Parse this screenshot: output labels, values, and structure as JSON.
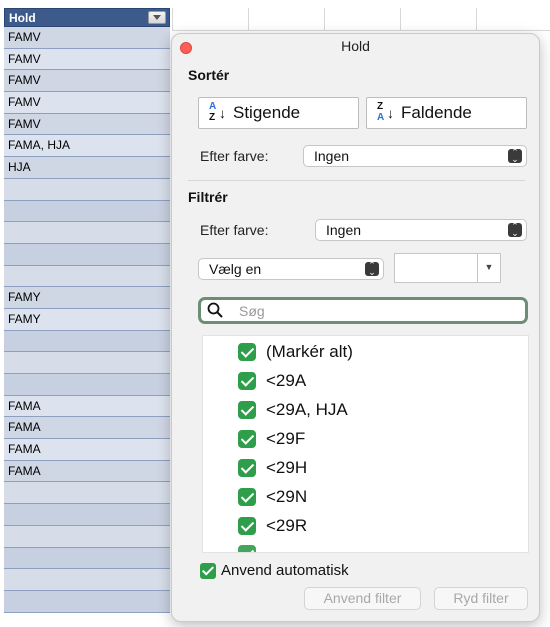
{
  "column": {
    "header": "Hold",
    "rows": [
      "FAMV",
      "FAMV",
      "FAMV",
      "FAMV",
      "FAMV",
      "FAMA, HJA",
      "HJA",
      "",
      "",
      "",
      "",
      "",
      "FAMY",
      "FAMY",
      "",
      "",
      "",
      "FAMA",
      "FAMA",
      "FAMA",
      "FAMA",
      "",
      "",
      "",
      "",
      "",
      ""
    ]
  },
  "panel": {
    "title": "Hold",
    "sort": {
      "heading": "Sortér",
      "ascending": "Stigende",
      "descending": "Faldende",
      "by_color_label": "Efter farve:",
      "by_color_value": "Ingen"
    },
    "filter": {
      "heading": "Filtrér",
      "by_color_label": "Efter farve:",
      "by_color_value": "Ingen",
      "choose": "Vælg en",
      "combo_value": "",
      "search_placeholder": "Søg"
    },
    "values": [
      "(Markér alt)",
      "<29A",
      "<29A, HJA",
      "<29F",
      "<29H",
      "<29N",
      "<29R"
    ],
    "auto_apply": "Anvend automatisk",
    "apply_button": "Anvend filter",
    "clear_button": "Ryd filter"
  }
}
